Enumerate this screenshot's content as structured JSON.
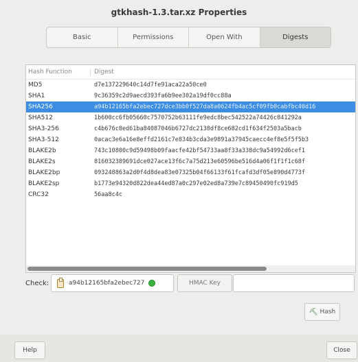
{
  "window": {
    "title": "gtkhash-1.3.tar.xz Properties"
  },
  "tabs": [
    {
      "label": "Basic",
      "active": false
    },
    {
      "label": "Permissions",
      "active": false
    },
    {
      "label": "Open With",
      "active": false
    },
    {
      "label": "Digests",
      "active": true
    }
  ],
  "table": {
    "headers": {
      "function": "Hash Function",
      "digest": "Digest"
    },
    "rows": [
      {
        "function": "MD5",
        "digest": "d7e137229640c14d7fe91aca22a50ce0"
      },
      {
        "function": "SHA1",
        "digest": "9c36359c2d9aecd393fa6b9ee302a19df0cc88a"
      },
      {
        "function": "SHA256",
        "digest": "a94b12165bfa2ebec727dce3bb0f527da8a0624fb4ac5cf09fb0cabfbc40d16"
      },
      {
        "function": "SHA512",
        "digest": "1b600cc6fb05660c7570752b63111fe9edc8bec542522a74426c841292a"
      },
      {
        "function": "SHA3-256",
        "digest": "c4b676c8ed61ba84087046b6727dc2138df8ce682cd1f634f2503a5bacb"
      },
      {
        "function": "SHA3-512",
        "digest": "0acac3e6a16e8effd2161c7e834b3cda3e9891a37945caecc4ef8e5f5f5b3"
      },
      {
        "function": "BLAKE2b",
        "digest": "743c10800c9d59498b09faacfe42bf54733aa8f33a338dc9a54992d6cef1"
      },
      {
        "function": "BLAKE2s",
        "digest": "816032389691dce027ace13f6c7a75d213e60596be516d4a06f1f1f1c68f"
      },
      {
        "function": "BLAKE2bp",
        "digest": "093248863a2d0f4d8dea83e07325b04f66133f61fcafd3df05e890d4773f"
      },
      {
        "function": "BLAKE2sp",
        "digest": "b1773e94320d822dea44ed87a0c297e02ed8a739e7c89450490fc919d5"
      },
      {
        "function": "CRC32",
        "digest": "56aa8c4c"
      }
    ],
    "selected_index": 2
  },
  "check": {
    "label": "Check:",
    "value": "a94b12165bfa2ebec727",
    "icon": "clipboard-icon",
    "status": "match"
  },
  "hmac": {
    "label": "HMAC Key",
    "value": ""
  },
  "hash_button": {
    "label": "Hash",
    "icon": "hash-icon"
  },
  "help_button": {
    "label": "Help"
  },
  "close_button": {
    "label": "Close"
  },
  "colors": {
    "selection": "#3d8ee3",
    "status_ok": "#3bb041"
  }
}
